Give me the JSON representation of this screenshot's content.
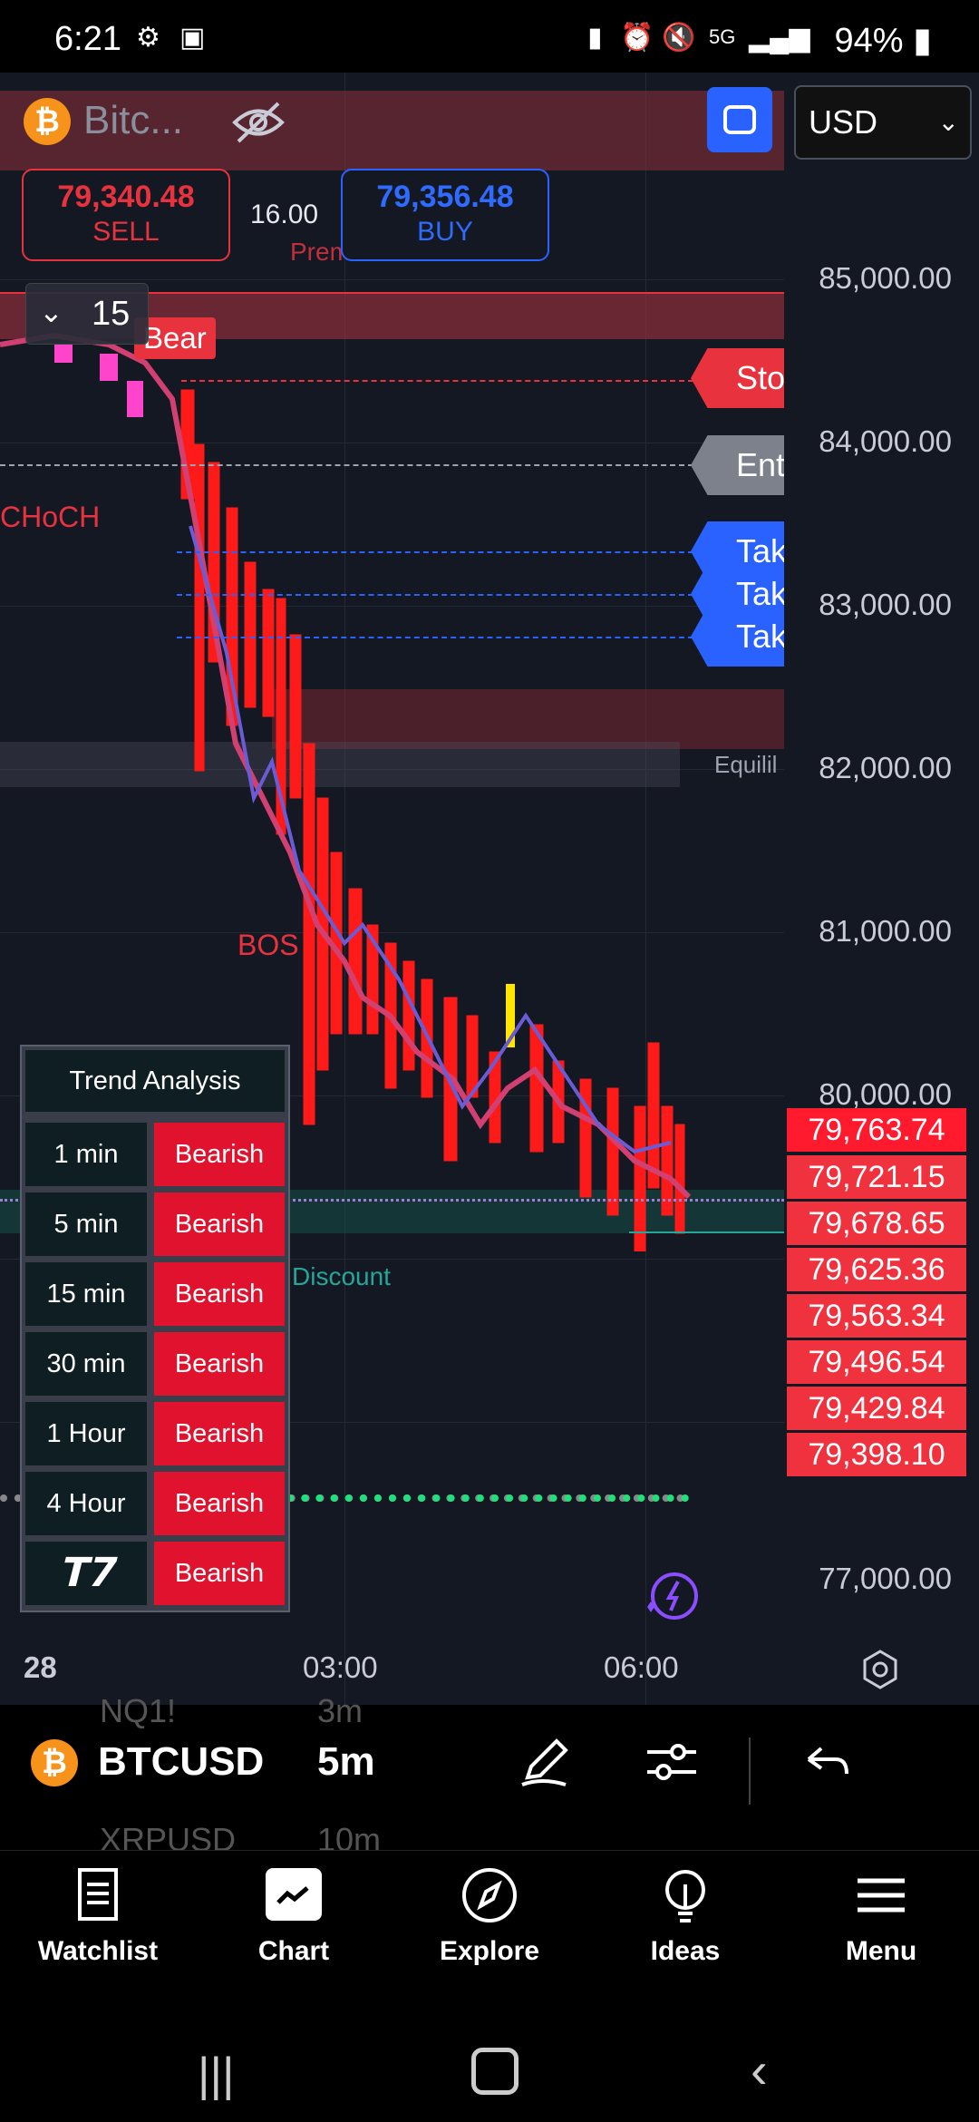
{
  "status_bar": {
    "time": "6:21",
    "battery": "94%",
    "network": "5G"
  },
  "header": {
    "symbol_short": "Bitc...",
    "currency": "USD",
    "sell_price": "79,340.48",
    "sell_label": "SELL",
    "buy_price": "79,356.48",
    "buy_label": "BUY",
    "spread": "16.00",
    "interval": "15"
  },
  "chart": {
    "price_axis": [
      "85,000.00",
      "84,000.00",
      "83,000.00",
      "82,000.00",
      "81,000.00",
      "80,000.00",
      "77,000.00"
    ],
    "time_axis": [
      "28",
      "03:00",
      "06:00"
    ],
    "labels": {
      "bear": "Bear",
      "choch": "CHoCH",
      "bos": "BOS",
      "discount": "Discount",
      "premium": "Prem",
      "equilibrium": "Equilil"
    },
    "tags": {
      "stop": "Sto",
      "entry": "Entr",
      "take1": "Tak",
      "take2": "Tak",
      "take3": "Tak"
    },
    "price_stack": [
      "79,763.74",
      "79,721.15",
      "79,678.65",
      "79,625.36",
      "79,563.34",
      "79,496.54",
      "79,429.84",
      "79,398.10"
    ]
  },
  "trend_analysis": {
    "title": "Trend Analysis",
    "rows": [
      {
        "tf": "1 min",
        "signal": "Bearish"
      },
      {
        "tf": "5 min",
        "signal": "Bearish"
      },
      {
        "tf": "15 min",
        "signal": "Bearish"
      },
      {
        "tf": "30 min",
        "signal": "Bearish"
      },
      {
        "tf": "1 Hour",
        "signal": "Bearish"
      },
      {
        "tf": "4 Hour",
        "signal": "Bearish"
      },
      {
        "tf": "",
        "signal": "Bearish"
      }
    ]
  },
  "toolbar": {
    "symbol": "BTCUSD",
    "interval": "5m",
    "ghost_prev_symbol": "NQ1!",
    "ghost_prev_interval": "3m",
    "ghost_next_symbol": "XRPUSD",
    "ghost_next_interval": "10m"
  },
  "nav": {
    "watchlist": "Watchlist",
    "chart": "Chart",
    "explore": "Explore",
    "ideas": "Ideas",
    "menu": "Menu"
  },
  "colors": {
    "bearish": "#e0122d",
    "accent": "#2962ff",
    "price_tag": "#f0313e"
  }
}
